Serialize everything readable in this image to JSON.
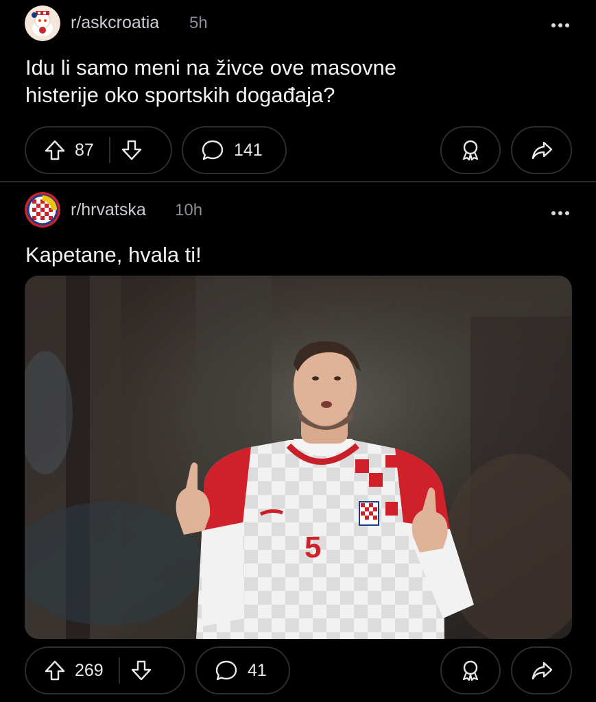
{
  "posts": [
    {
      "subreddit": "r/askcroatia",
      "age": "5h",
      "title_lines": [
        "Idu li samo meni na živce ove masovne",
        "histerije oko sportskih događaja?"
      ],
      "upvotes": "87",
      "comments": "141"
    },
    {
      "subreddit": "r/hrvatska",
      "age": "10h",
      "title_lines": [
        "Kapetane, hvala ti!"
      ],
      "upvotes": "269",
      "comments": "41",
      "image": {
        "description": "handball player in red-white checkered jersey pointing upward",
        "jersey_number": "5"
      }
    }
  ],
  "icons": {
    "upvote": "arrow-up-icon",
    "downvote": "arrow-down-icon",
    "comment": "speech-bubble-icon",
    "award": "award-icon",
    "share": "share-icon",
    "more": "more-dots-icon"
  },
  "colors": {
    "background": "#000000",
    "pill_border": "#2c2d31",
    "meta_text": "#8b9096"
  }
}
